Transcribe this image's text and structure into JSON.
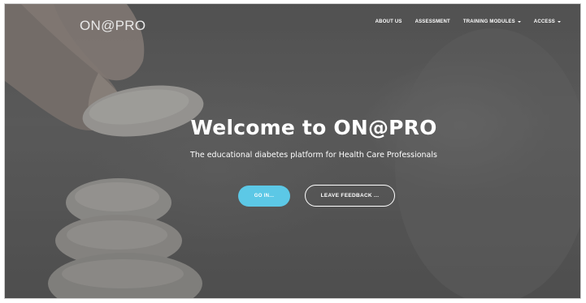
{
  "nav": {
    "logo": "ON@PRO",
    "items": [
      {
        "label": "ABOUT US",
        "dropdown": false
      },
      {
        "label": "ASSESSMENT",
        "dropdown": false
      },
      {
        "label": "TRAINING MODULES",
        "dropdown": true
      },
      {
        "label": "ACCESS",
        "dropdown": true
      }
    ]
  },
  "hero": {
    "title": "Welcome to ON@PRO",
    "subtitle": "The educational diabetes platform for Health Care Professionals",
    "primary_button": "GO IN...",
    "secondary_button": "LEAVE FEEDBACK ..."
  },
  "colors": {
    "accent": "#5cc8e6",
    "overlay": "#5f5f5f",
    "text": "#ffffff"
  }
}
